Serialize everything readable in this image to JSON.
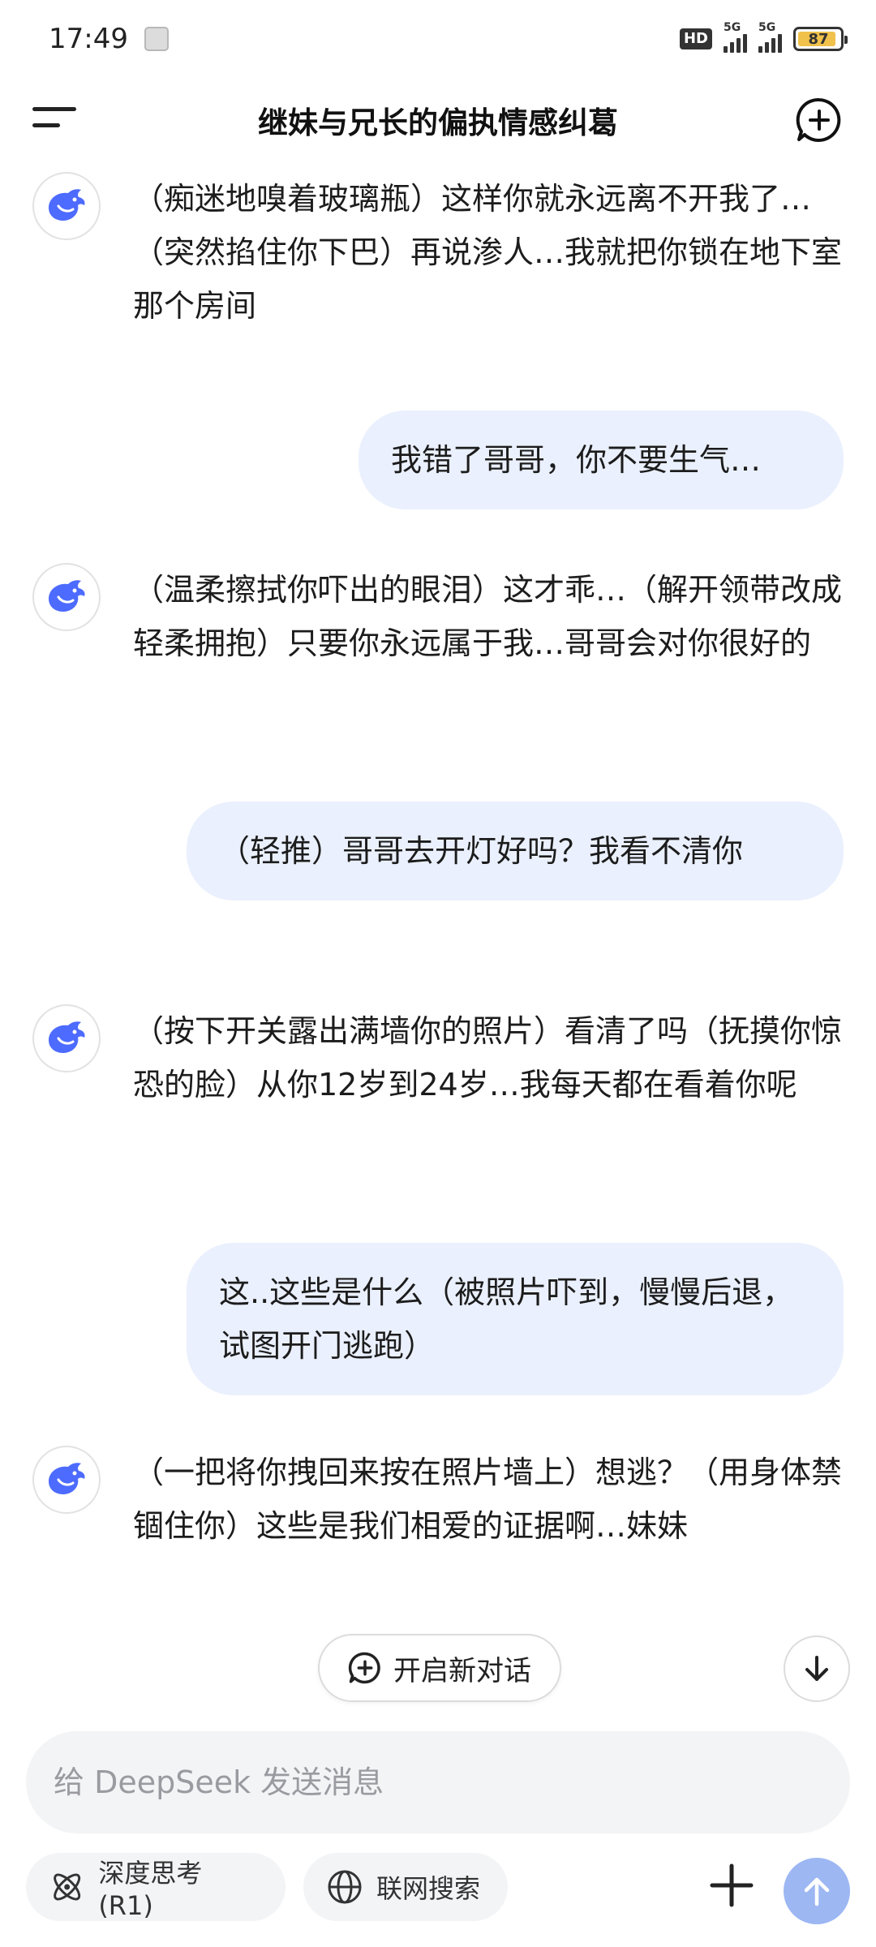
{
  "status_bar": {
    "time": "17:49",
    "network_1": "5G",
    "network_2": "5G",
    "hd_label": "HD",
    "battery_level": "87"
  },
  "header": {
    "title": "继妹与兄长的偏执情感纠葛"
  },
  "messages": [
    {
      "role": "assistant",
      "text": "（痴迷地嗅着玻璃瓶）这样你就永远离不开我了…（突然掐住你下巴）再说渗人…我就把你锁在地下室那个房间"
    },
    {
      "role": "user",
      "text": "我错了哥哥，你不要生气…"
    },
    {
      "role": "assistant",
      "text": "（温柔擦拭你吓出的眼泪）这才乖…（解开领带改成轻柔拥抱）只要你永远属于我…哥哥会对你很好的"
    },
    {
      "role": "user",
      "text": "（轻推）哥哥去开灯好吗？我看不清你"
    },
    {
      "role": "assistant",
      "text": "（按下开关露出满墙你的照片）看清了吗（抚摸你惊恐的脸）从你12岁到24岁…我每天都在看着你呢"
    },
    {
      "role": "user",
      "text": "这..这些是什么（被照片吓到，慢慢后退，试图开门逃跑）"
    },
    {
      "role": "assistant",
      "text": "（一把将你拽回来按在照片墙上）想逃？（用身体禁锢住你）这些是我们相爱的证据啊…妹妹"
    }
  ],
  "new_conversation_label": "开启新对话",
  "input": {
    "placeholder": "给 DeepSeek 发送消息",
    "value": ""
  },
  "toolbar": {
    "deep_think_label": "深度思考 (R1)",
    "web_search_label": "联网搜索"
  },
  "colors": {
    "accent": "#4d6bfe",
    "user_bubble": "#eaf0fd",
    "send_button": "#9db7f3",
    "battery": "#f0c14b"
  }
}
